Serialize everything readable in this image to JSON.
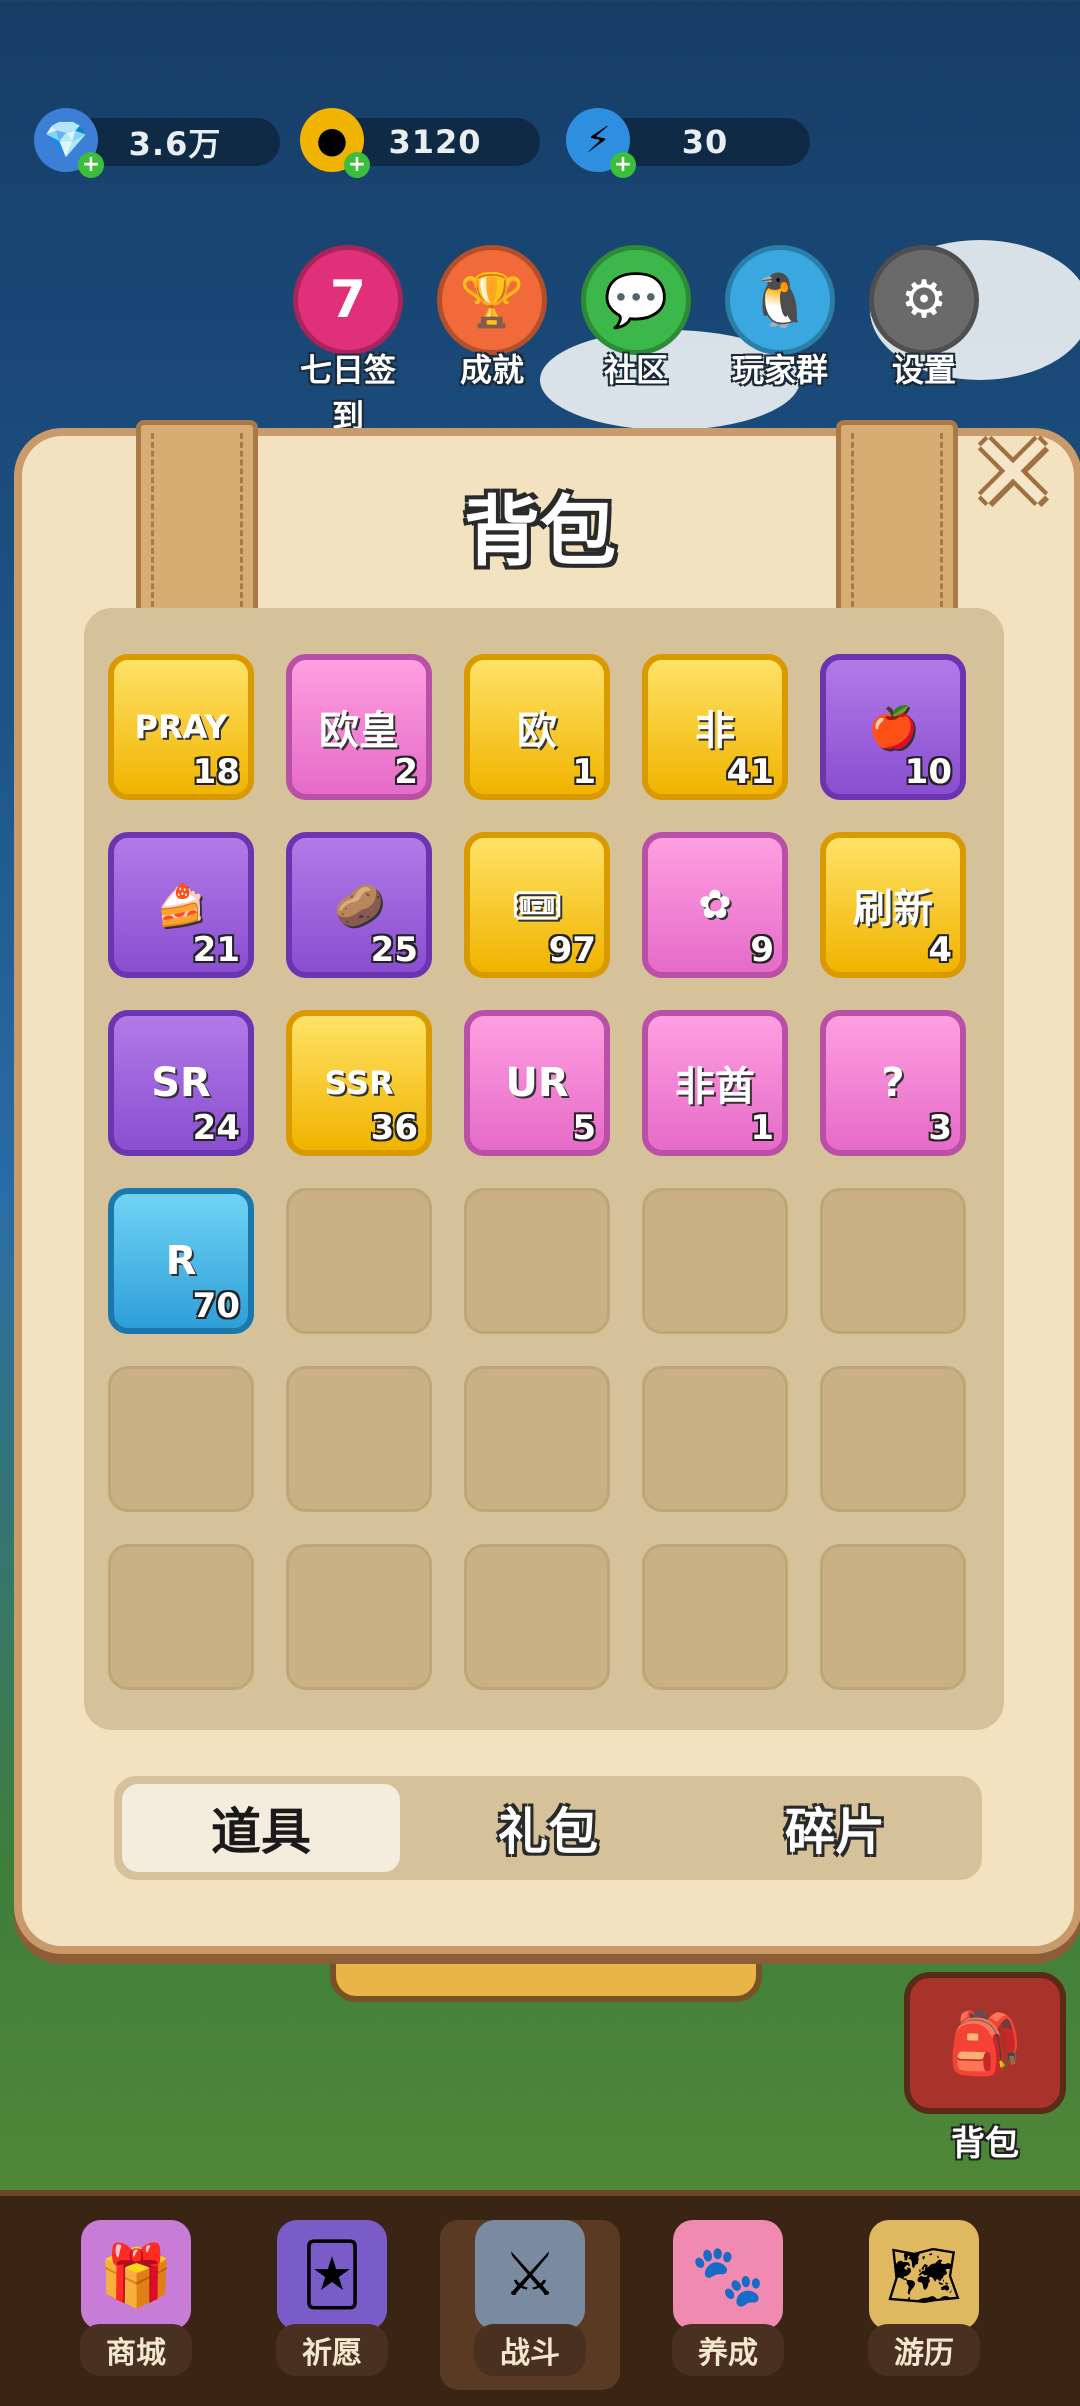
{
  "resources": [
    {
      "icon": "gem-icon",
      "value": "3.6万"
    },
    {
      "icon": "coin-icon",
      "value": "3120"
    },
    {
      "icon": "energy-icon",
      "value": "30"
    }
  ],
  "top_menu": [
    {
      "name": "checkin",
      "label": "七日签到",
      "glyph": "7",
      "color": "#e0307a"
    },
    {
      "name": "achievement",
      "label": "成就",
      "glyph": "🏆",
      "color": "#f06a3a"
    },
    {
      "name": "community",
      "label": "社区",
      "glyph": "💬",
      "color": "#3cb84a"
    },
    {
      "name": "player-group",
      "label": "玩家群",
      "glyph": "🐧",
      "color": "#3aa8e0"
    },
    {
      "name": "settings",
      "label": "设置",
      "glyph": "⚙",
      "color": "#6a6a6a"
    }
  ],
  "panel": {
    "title": "背包",
    "close_glyph": "✕"
  },
  "items": [
    {
      "name": "pray-ticket",
      "glyph": "PRAY",
      "count": "18",
      "frame": "gold"
    },
    {
      "name": "ouhuang-ticket-pink",
      "glyph": "欧皇",
      "count": "2",
      "frame": "pink"
    },
    {
      "name": "ouhuang-ticket-broken",
      "glyph": "欧",
      "count": "1",
      "frame": "gold"
    },
    {
      "name": "feiqiu-ticket-broken",
      "glyph": "非",
      "count": "41",
      "frame": "gold"
    },
    {
      "name": "apple",
      "glyph": "🍎",
      "count": "10",
      "frame": "purple"
    },
    {
      "name": "cake",
      "glyph": "🍰",
      "count": "21",
      "frame": "purple"
    },
    {
      "name": "chips",
      "glyph": "🥔",
      "count": "25",
      "frame": "purple"
    },
    {
      "name": "pink-ticket",
      "glyph": "🎟",
      "count": "97",
      "frame": "gold"
    },
    {
      "name": "sakura",
      "glyph": "✿",
      "count": "9",
      "frame": "pink"
    },
    {
      "name": "refresh-card",
      "glyph": "刷新",
      "count": "4",
      "frame": "gold"
    },
    {
      "name": "sr-fragment",
      "glyph": "SR",
      "count": "24",
      "frame": "purple"
    },
    {
      "name": "ssr-fragment",
      "glyph": "SSR",
      "count": "36",
      "frame": "gold"
    },
    {
      "name": "ur-fragment",
      "glyph": "UR",
      "count": "5",
      "frame": "pink"
    },
    {
      "name": "feiqiu-ticket",
      "glyph": "非酋",
      "count": "1",
      "frame": "pink"
    },
    {
      "name": "mystery-pack",
      "glyph": "?",
      "count": "3",
      "frame": "pink"
    },
    {
      "name": "r-fragment",
      "glyph": "R",
      "count": "70",
      "frame": "blue"
    }
  ],
  "tabs": [
    {
      "name": "tab-items",
      "label": "道具",
      "active": true
    },
    {
      "name": "tab-gifts",
      "label": "礼包",
      "active": false
    },
    {
      "name": "tab-fragments",
      "label": "碎片",
      "active": false
    }
  ],
  "bag_button": {
    "label": "背包"
  },
  "bottom_nav": [
    {
      "name": "shop",
      "label": "商城",
      "glyph": "🎁"
    },
    {
      "name": "pray",
      "label": "祈愿",
      "glyph": "🃏"
    },
    {
      "name": "battle",
      "label": "战斗",
      "glyph": "⚔",
      "active": true
    },
    {
      "name": "nurture",
      "label": "养成",
      "glyph": "🐾"
    },
    {
      "name": "travel",
      "label": "游历",
      "glyph": "🗺"
    }
  ]
}
